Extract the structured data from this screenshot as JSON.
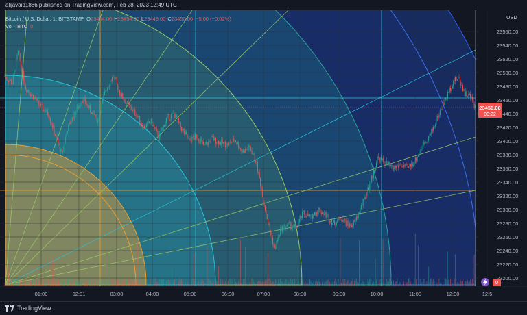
{
  "header": {
    "publish_line": "alijavaid1886 published on TradingView.com, Feb 28, 2023 12:49 UTC"
  },
  "footer": {
    "brand": "TradingView"
  },
  "colors": {
    "background": "#131722",
    "candle_up": "#26a69a",
    "candle_down": "#ef5350",
    "orange": "#f0a030",
    "cyan": "#26c6da",
    "green": "#66bb6a",
    "teal": "#26a69a",
    "blue": "#2962ff"
  },
  "icons": {
    "lightning_badge": "lightning-icon"
  },
  "chart_data": {
    "type": "candlestick",
    "symbol_line": {
      "title": "Bitcoin / U.S. Dollar, 1, BITSTAMP",
      "o_label": "O",
      "o_value": "23454.00",
      "h_label": "H",
      "h_value": "23454.00",
      "l_label": "L",
      "l_value": "23449.00",
      "c_label": "C",
      "c_value": "23450.00",
      "change": "−5.00 (−0.02%)"
    },
    "volume_line": {
      "label": "Vol · BTC",
      "value": "0"
    },
    "currency": "USD",
    "ylim": [
      23180,
      23580
    ],
    "yticks": [
      "23560.00",
      "23540.00",
      "23520.00",
      "23500.00",
      "23480.00",
      "23460.00",
      "23440.00",
      "23420.00",
      "23400.00",
      "23380.00",
      "23360.00",
      "23340.00",
      "23320.00",
      "23300.00",
      "23280.00",
      "23260.00",
      "23240.00",
      "23220.00",
      "23200.00"
    ],
    "xticks": [
      "01:00",
      "02:01",
      "03:00",
      "04:00",
      "05:00",
      "06:00",
      "07:00",
      "08:00",
      "09:00",
      "10:00",
      "11:00",
      "12:00",
      "12:5"
    ],
    "last_price": "23450.00",
    "countdown": "00:22",
    "volume_badge": "0",
    "price_path": [
      [
        0,
        23495
      ],
      [
        8,
        23485
      ],
      [
        14,
        23530
      ],
      [
        22,
        23478
      ],
      [
        30,
        23465
      ],
      [
        38,
        23450
      ],
      [
        46,
        23440
      ],
      [
        54,
        23405
      ],
      [
        60,
        23380
      ],
      [
        66,
        23418
      ],
      [
        74,
        23442
      ],
      [
        82,
        23462
      ],
      [
        90,
        23445
      ],
      [
        98,
        23430
      ],
      [
        106,
        23475
      ],
      [
        114,
        23495
      ],
      [
        122,
        23468
      ],
      [
        130,
        23452
      ],
      [
        138,
        23440
      ],
      [
        146,
        23420
      ],
      [
        154,
        23428
      ],
      [
        162,
        23405
      ],
      [
        170,
        23432
      ],
      [
        178,
        23440
      ],
      [
        186,
        23418
      ],
      [
        194,
        23400
      ],
      [
        202,
        23408
      ],
      [
        210,
        23392
      ],
      [
        218,
        23404
      ],
      [
        226,
        23398
      ],
      [
        234,
        23395
      ],
      [
        242,
        23402
      ],
      [
        250,
        23385
      ],
      [
        258,
        23390
      ],
      [
        264,
        23372
      ],
      [
        268,
        23345
      ],
      [
        272,
        23315
      ],
      [
        278,
        23275
      ],
      [
        284,
        23242
      ],
      [
        290,
        23270
      ],
      [
        298,
        23278
      ],
      [
        306,
        23272
      ],
      [
        314,
        23295
      ],
      [
        322,
        23288
      ],
      [
        330,
        23300
      ],
      [
        338,
        23292
      ],
      [
        346,
        23280
      ],
      [
        354,
        23288
      ],
      [
        362,
        23276
      ],
      [
        368,
        23280
      ],
      [
        374,
        23300
      ],
      [
        380,
        23322
      ],
      [
        386,
        23345
      ],
      [
        392,
        23375
      ],
      [
        400,
        23368
      ],
      [
        408,
        23360
      ],
      [
        416,
        23365
      ],
      [
        424,
        23360
      ],
      [
        432,
        23372
      ],
      [
        440,
        23395
      ],
      [
        448,
        23410
      ],
      [
        454,
        23430
      ],
      [
        460,
        23450
      ],
      [
        466,
        23468
      ],
      [
        472,
        23488
      ],
      [
        478,
        23492
      ],
      [
        484,
        23470
      ],
      [
        490,
        23465
      ],
      [
        495,
        23450
      ]
    ]
  }
}
